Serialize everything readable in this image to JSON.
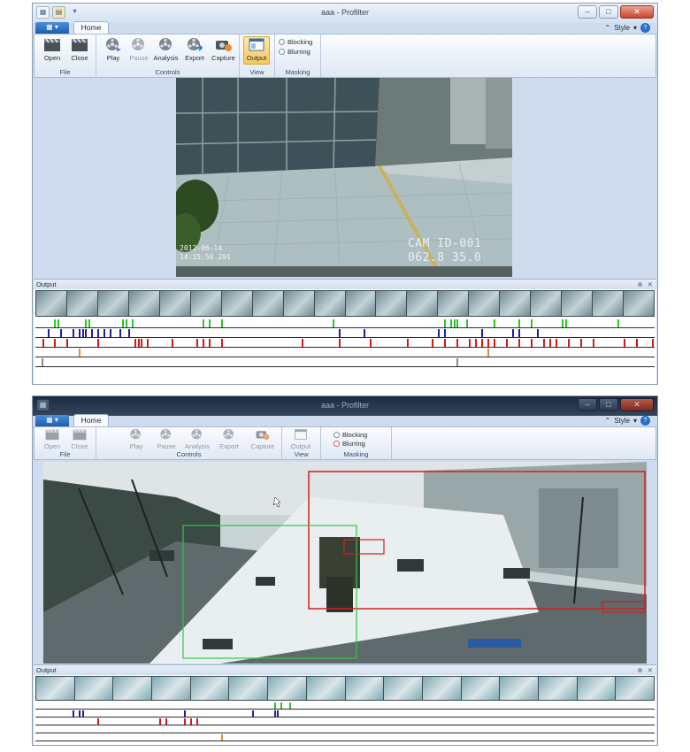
{
  "colors": {
    "selected_button": "#f6c85a",
    "ribbon_bg": "#dfe8f4",
    "frame_bg": "#cfdcee",
    "track_green": "#2cc52c",
    "track_blue": "#1c1fa6",
    "track_red": "#d11a1a",
    "track_orange": "#ef8a2c",
    "roi_red": "#d02020",
    "roi_green": "#33c64a"
  },
  "windows": [
    {
      "title": "aaa - Profilter",
      "tab": "Home",
      "style_menu": "Style",
      "groups": [
        {
          "label": "File",
          "buttons": [
            {
              "label": "Open",
              "icon": "clapperboard-icon"
            },
            {
              "label": "Close",
              "icon": "clapperboard-icon"
            }
          ]
        },
        {
          "label": "Controls",
          "buttons": [
            {
              "label": "Play",
              "icon": "film-reel-icon"
            },
            {
              "label": "Pause",
              "icon": "film-reel-icon"
            },
            {
              "label": "Analysis",
              "icon": "film-reel-icon"
            },
            {
              "label": "Export",
              "icon": "film-reel-icon"
            },
            {
              "label": "Capture",
              "icon": "camera-icon"
            }
          ]
        },
        {
          "label": "View",
          "buttons": [
            {
              "label": "Output",
              "icon": "window-icon"
            }
          ]
        },
        {
          "label": "Masking",
          "options": [
            "Blocking",
            "Blurring"
          ]
        }
      ],
      "video_overlay": {
        "date": "2012-06-14",
        "time": "14:15:56.291",
        "cam_id": "CAM ID-001",
        "coords": "062.8 35.0"
      },
      "output": {
        "title": "Output",
        "tracks": [
          {
            "color": "#2cc52c",
            "marks": [
              0.03,
              0.035,
              0.08,
              0.085,
              0.14,
              0.145,
              0.155,
              0.27,
              0.28,
              0.3,
              0.48,
              0.66,
              0.67,
              0.675,
              0.68,
              0.695,
              0.74,
              0.78,
              0.8,
              0.85,
              0.855,
              0.94
            ]
          },
          {
            "color": "#1c1fa6",
            "marks": [
              0.02,
              0.04,
              0.06,
              0.07,
              0.075,
              0.08,
              0.09,
              0.1,
              0.11,
              0.12,
              0.135,
              0.15,
              0.49,
              0.53,
              0.65,
              0.66,
              0.72,
              0.77,
              0.78,
              0.81
            ]
          },
          {
            "color": "#d11a1a",
            "marks": [
              0.012,
              0.03,
              0.05,
              0.1,
              0.16,
              0.165,
              0.17,
              0.18,
              0.22,
              0.26,
              0.27,
              0.28,
              0.3,
              0.43,
              0.49,
              0.54,
              0.6,
              0.64,
              0.66,
              0.68,
              0.7,
              0.71,
              0.72,
              0.73,
              0.74,
              0.76,
              0.78,
              0.8,
              0.82,
              0.83,
              0.84,
              0.86,
              0.88,
              0.9,
              0.95,
              0.97,
              0.995
            ]
          },
          {
            "color": "#ef8a2c",
            "marks": [
              0.07,
              0.73
            ]
          },
          {
            "color": "#8a8a8a",
            "marks": [
              0.01,
              0.68
            ]
          }
        ]
      }
    },
    {
      "title": "aaa - Profilter",
      "tab": "Home",
      "style_menu": "Style",
      "groups": [
        {
          "label": "File",
          "buttons": [
            {
              "label": "Open",
              "icon": "clapperboard-icon"
            },
            {
              "label": "Close",
              "icon": "clapperboard-icon"
            }
          ]
        },
        {
          "label": "Controls",
          "buttons": [
            {
              "label": "Play",
              "icon": "film-reel-icon"
            },
            {
              "label": "Pause",
              "icon": "film-reel-icon"
            },
            {
              "label": "Analysis",
              "icon": "film-reel-icon"
            },
            {
              "label": "Export",
              "icon": "film-reel-icon"
            },
            {
              "label": "Capture",
              "icon": "camera-icon"
            }
          ]
        },
        {
          "label": "View",
          "buttons": [
            {
              "label": "Output",
              "icon": "window-icon"
            }
          ]
        },
        {
          "label": "Masking",
          "options": [
            "Blocking",
            "Blurring"
          ]
        }
      ],
      "output": {
        "title": "Output",
        "tracks": [
          {
            "color": "#2cc52c",
            "marks": [
              0.385,
              0.395,
              0.41
            ]
          },
          {
            "color": "#1c1fa6",
            "marks": [
              0.06,
              0.07,
              0.075,
              0.24,
              0.35,
              0.385,
              0.39
            ]
          },
          {
            "color": "#d11a1a",
            "marks": [
              0.1,
              0.2,
              0.21,
              0.24,
              0.25,
              0.26
            ]
          },
          {
            "color": "#8a8a8a",
            "marks": []
          },
          {
            "color": "#ef8a2c",
            "marks": [
              0.3
            ]
          }
        ]
      }
    }
  ]
}
